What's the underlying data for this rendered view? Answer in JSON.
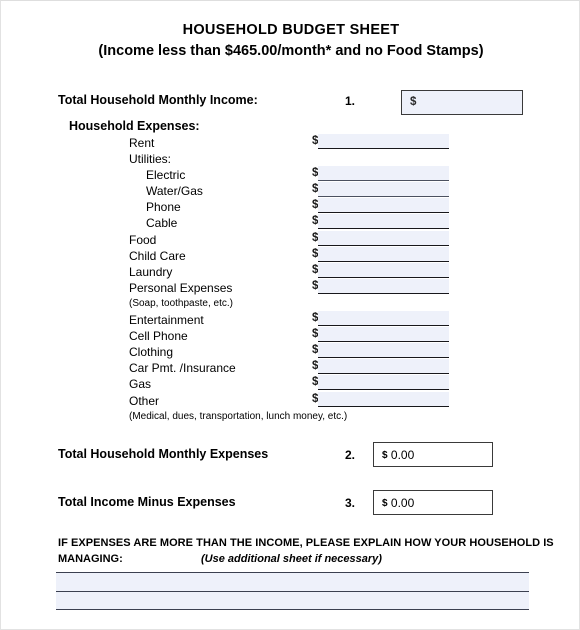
{
  "document": {
    "title_main": "HOUSEHOLD BUDGET SHEET",
    "title_sub": "(Income less than $465.00/month* and no Food Stamps)"
  },
  "income": {
    "label": "Total Household Monthly Income:",
    "marker": "1.",
    "currency_symbol": "$",
    "value": ""
  },
  "expenses": {
    "heading": "Household Expenses:",
    "currency_symbol": "$",
    "rows": [
      {
        "label": "Rent",
        "indent": 1,
        "line": true,
        "weight": "heavy"
      },
      {
        "label": "Utilities:",
        "indent": 1,
        "line": false,
        "weight": "none"
      },
      {
        "label": "Electric",
        "indent": 2,
        "line": true,
        "weight": "thin"
      },
      {
        "label": "Water/Gas",
        "indent": 2,
        "line": true,
        "weight": "thin"
      },
      {
        "label": "Phone",
        "indent": 2,
        "line": true,
        "weight": "heavy"
      },
      {
        "label": "Cable",
        "indent": 2,
        "line": true,
        "weight": "heavy"
      },
      {
        "label": "Food",
        "indent": 1,
        "line": true,
        "weight": "heavy"
      },
      {
        "label": "Child Care",
        "indent": 1,
        "line": true,
        "weight": "heavy"
      },
      {
        "label": "Laundry",
        "indent": 1,
        "line": true,
        "weight": "heavy"
      },
      {
        "label": "Personal Expenses",
        "indent": 1,
        "line": true,
        "weight": "heavy"
      },
      {
        "label": "(Soap, toothpaste, etc.)",
        "indent": 0,
        "line": false,
        "weight": "none",
        "note": true
      },
      {
        "label": "Entertainment",
        "indent": 1,
        "line": true,
        "weight": "heavy"
      },
      {
        "label": "Cell Phone",
        "indent": 1,
        "line": true,
        "weight": "heavy"
      },
      {
        "label": "Clothing",
        "indent": 1,
        "line": true,
        "weight": "heavy"
      },
      {
        "label": "Car Pmt. /Insurance",
        "indent": 1,
        "line": true,
        "weight": "heavy"
      },
      {
        "label": "Gas",
        "indent": 1,
        "line": true,
        "weight": "heavy"
      },
      {
        "label": "Other",
        "indent": 1,
        "line": true,
        "weight": "heavy"
      },
      {
        "label": "(Medical, dues, transportation, lunch money, etc.)",
        "indent": 0,
        "line": false,
        "weight": "none",
        "note": true
      }
    ]
  },
  "totals": {
    "expenses": {
      "label": "Total Household Monthly Expenses",
      "marker": "2.",
      "currency_symbol": "$",
      "value": "0.00"
    },
    "income_minus_expenses": {
      "label": "Total Income Minus Expenses",
      "marker": "3.",
      "currency_symbol": "$",
      "value": "0.00"
    }
  },
  "explain": {
    "line1": "IF EXPENSES ARE MORE THAN THE INCOME, PLEASE EXPLAIN HOW YOUR HOUSEHOLD IS",
    "line2": "MANAGING:",
    "hint": "(Use additional sheet if necessary)",
    "write_lines": [
      "",
      ""
    ]
  },
  "colors": {
    "field_fill": "#eef1fa",
    "rule_dark": "#17171b",
    "rule_light": "#4b5160",
    "box_border": "#3a3a3a",
    "page_border": "#e2e2e2"
  }
}
